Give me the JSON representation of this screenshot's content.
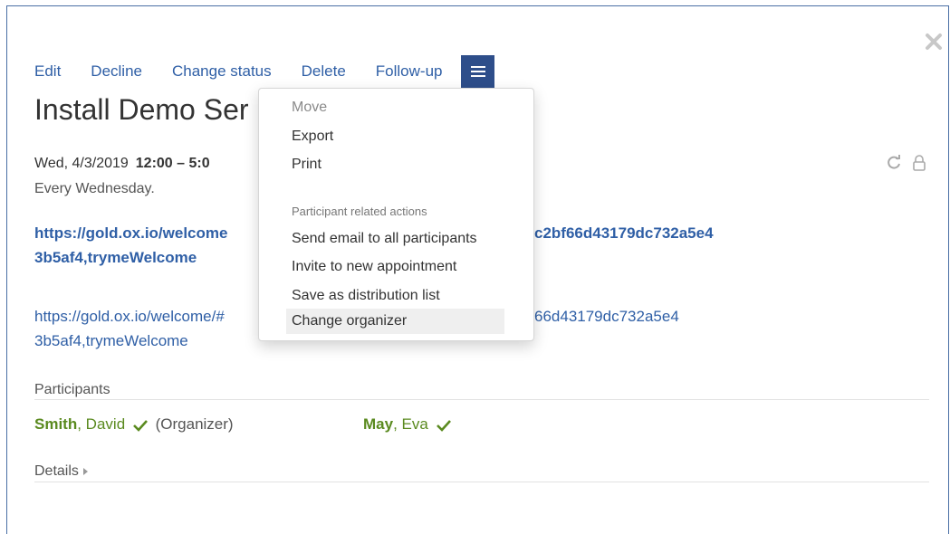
{
  "toolbar": {
    "edit": "Edit",
    "decline": "Decline",
    "change_status": "Change status",
    "delete": "Delete",
    "follow_up": "Follow-up",
    "menu_icon": "hamburger-icon"
  },
  "appointment": {
    "title": "Install Demo Ser",
    "date": "Wed, 4/3/2019",
    "time": "12:00 – 5:0",
    "recurrence": "Every Wednesday.",
    "link_bold_line1_left": "https://gold.ox.io/welcome",
    "link_bold_line1_right": "c2bf66d43179dc732a5e4",
    "link_bold_line2": "3b5af4,trymeWelcome",
    "link_plain_line1_left": "https://gold.ox.io/welcome/#",
    "link_plain_line1_right": "66d43179dc732a5e4",
    "link_plain_line2": "3b5af4,trymeWelcome"
  },
  "participants": {
    "label": "Participants",
    "items": [
      {
        "last": "Smith",
        "first": ", David",
        "role": "(Organizer)"
      },
      {
        "last": "May",
        "first": ", Eva",
        "role": ""
      }
    ]
  },
  "details": {
    "label": "Details"
  },
  "dropdown": {
    "items": [
      {
        "label": "Move",
        "disabled": true
      },
      {
        "label": "Export"
      },
      {
        "label": "Print"
      }
    ],
    "section_header": "Participant related actions",
    "participant_items": [
      {
        "label": "Send email to all participants"
      },
      {
        "label": "Invite to new appointment"
      },
      {
        "label": "Save as distribution list"
      },
      {
        "label": "Change organizer"
      }
    ]
  },
  "colors": {
    "link": "#2f5fa6",
    "accent": "#2e4e8a",
    "accepted": "#5a8a1f"
  }
}
